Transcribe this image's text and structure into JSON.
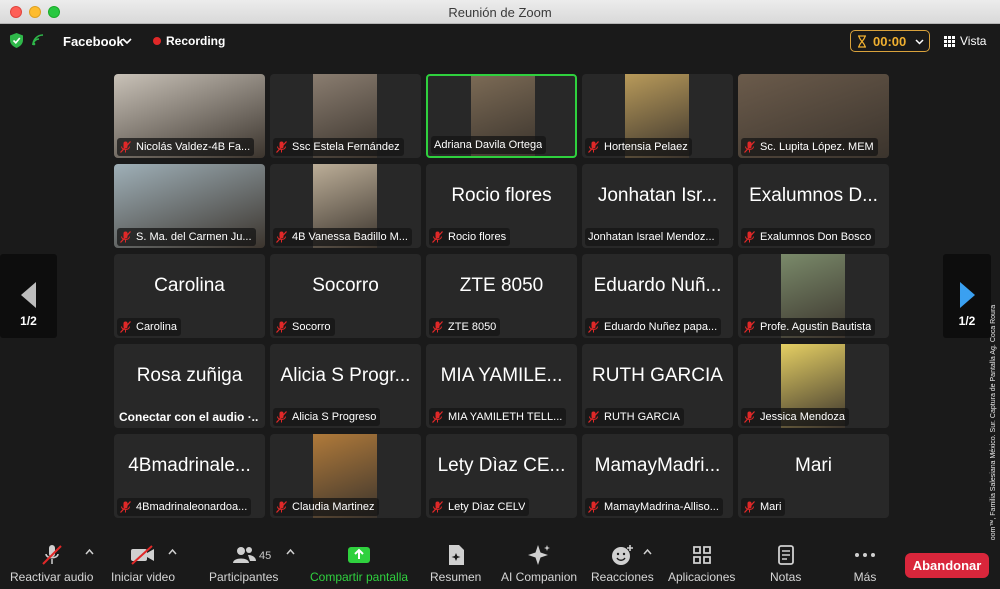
{
  "window": {
    "title": "Reunión de Zoom"
  },
  "topbar": {
    "stream_label": "Facebook",
    "recording_label": "Recording",
    "timer": "00:00",
    "view_label": "Vista"
  },
  "pagination": {
    "left_page": "1/2",
    "right_page": "1/2"
  },
  "tiles": [
    {
      "kind": "video",
      "label": "Nicolás Valdez-4B Fa...",
      "muted": true,
      "video_color": "#c9c2b8"
    },
    {
      "kind": "video",
      "label": "Ssc Estela Fernández",
      "muted": true,
      "video_color": "#8a7d70"
    },
    {
      "kind": "video",
      "label": "Adriana Davila Ortega",
      "muted": false,
      "active": true,
      "video_color": "#7b6a55"
    },
    {
      "kind": "video",
      "label": "Hortensia Pelaez",
      "muted": true,
      "video_color": "#b89a5a"
    },
    {
      "kind": "video",
      "label": "Sc. Lupita López. MEM",
      "muted": true,
      "video_color": "#6b5b4b"
    },
    {
      "kind": "video",
      "label": "S. Ma. del Carmen Ju...",
      "muted": true,
      "video_color": "#9fb0b8"
    },
    {
      "kind": "video",
      "label": "4B Vanessa Badillo M...",
      "muted": true,
      "video_color": "#bcae98"
    },
    {
      "kind": "name",
      "display": "Rocio flores",
      "label": "Rocio flores",
      "muted": true
    },
    {
      "kind": "name",
      "display": "Jonhatan Isr...",
      "label": "Jonhatan Israel Mendoz...",
      "muted": false
    },
    {
      "kind": "name",
      "display": "Exalumnos D...",
      "label": "Exalumnos Don Bosco",
      "muted": true
    },
    {
      "kind": "name",
      "display": "Carolina",
      "label": "Carolina",
      "muted": true
    },
    {
      "kind": "name",
      "display": "Socorro",
      "label": "Socorro",
      "muted": true
    },
    {
      "kind": "name",
      "display": "ZTE 8050",
      "label": "ZTE 8050",
      "muted": true
    },
    {
      "kind": "name",
      "display": "Eduardo Nuñ...",
      "label": "Eduardo Nuñez papa...",
      "muted": true
    },
    {
      "kind": "video",
      "label": "Profe. Agustin Bautista",
      "muted": true,
      "video_color": "#7a8a6a"
    },
    {
      "kind": "name",
      "display": "Rosa zuñiga",
      "label": "Conectar con el audio  ·..",
      "muted": false,
      "audio_prompt": true
    },
    {
      "kind": "name",
      "display": "Alicia S Progr...",
      "label": "Alicia S Progreso",
      "muted": true
    },
    {
      "kind": "name",
      "display": "MIA YAMILE...",
      "label": "MIA YAMILETH TELL...",
      "muted": true
    },
    {
      "kind": "name",
      "display": "RUTH GARCIA",
      "label": "RUTH GARCIA",
      "muted": true
    },
    {
      "kind": "video",
      "label": "Jessica Mendoza",
      "muted": true,
      "video_color": "#e5cf63"
    },
    {
      "kind": "name",
      "display": "4Bmadrinale...",
      "label": "4Bmadrinaleonardoa...",
      "muted": true
    },
    {
      "kind": "video",
      "label": "Claudia Martinez",
      "muted": true,
      "video_color": "#b07a3a"
    },
    {
      "kind": "name",
      "display": "Lety Dìaz CE...",
      "label": "Lety Dìaz CELV",
      "muted": true
    },
    {
      "kind": "name",
      "display": "MamayMadri...",
      "label": "MamayMadrina-Alliso...",
      "muted": true
    },
    {
      "kind": "name",
      "display": "Mari",
      "label": "Mari",
      "muted": true
    }
  ],
  "toolbar": {
    "mute_label": "Reactivar audio",
    "video_label": "Iniciar video",
    "participants_label": "Participantes",
    "participants_count": "45",
    "share_label": "Compartir pantalla",
    "summary_label": "Resumen",
    "companion_label": "AI Companion",
    "reactions_label": "Reacciones",
    "apps_label": "Aplicaciones",
    "notes_label": "Notas",
    "more_label": "Más",
    "leave_label": "Abandonar"
  },
  "credit": "Cortesía © Zoom™, Familia Salesiana México. Sur. Captura de Pantalla Ag. Coca Roura",
  "colors": {
    "accent_green": "#2fd13e",
    "leave_red": "#d9263b",
    "timer_amber": "#f0b030",
    "mute_red": "#e02828"
  }
}
